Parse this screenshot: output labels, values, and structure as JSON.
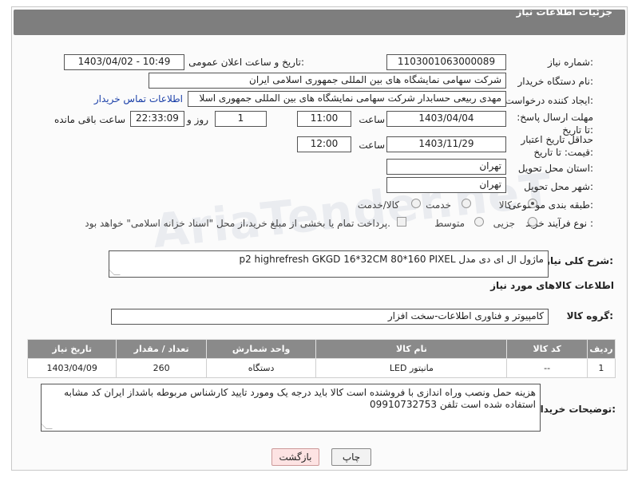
{
  "page": {
    "title": "جزئیات اطلاعات نیاز"
  },
  "need_number": {
    "label": "شماره نیاز:",
    "value": "1103001063000089"
  },
  "announce": {
    "label": "تاریخ و ساعت اعلان عمومی:",
    "value": "1403/04/02 - 10:49"
  },
  "buyer": {
    "label": "نام دستگاه خریدار:",
    "value": "شرکت سهامی نمایشگاه های بین المللی جمهوری اسلامی ایران"
  },
  "creator": {
    "label": "ایجاد کننده درخواست:",
    "value": "مهدی  ربیعی حسابدار شرکت سهامی نمایشگاه های بین المللی جمهوری اسلا",
    "contact_link": "اطلاعات تماس خریدار"
  },
  "deadline": {
    "label": "مهلت ارسال پاسخ: تا تاریخ:",
    "date": "1403/04/04",
    "time_label": "ساعت",
    "time": "11:00",
    "days": "1",
    "days_label": "روز و",
    "remaining": "22:33:09",
    "remaining_label": "ساعت باقی مانده"
  },
  "validity": {
    "label": "حداقل تاریخ اعتبار قیمت: تا تاریخ:",
    "date": "1403/11/29",
    "time_label": "ساعت",
    "time": "12:00"
  },
  "province": {
    "label": "استان محل تحویل:",
    "value": "تهران"
  },
  "city": {
    "label": "شهر محل تحویل:",
    "value": "تهران"
  },
  "category": {
    "label": "طبقه بندی موضوعی:",
    "options": [
      "کالا",
      "خدمت",
      "کالا/خدمت"
    ],
    "selected": "کالا"
  },
  "process": {
    "label": "نوع فرآیند خرید :",
    "options": [
      "جزیی",
      "متوسط"
    ],
    "note": "پرداخت تمام یا بخشی از مبلغ خرید،از محل \"اسناد خزانه اسلامی\" خواهد بود."
  },
  "description": {
    "label": "شرح کلی نیاز:",
    "value": "ماژول ال ای دی مدل  p2 highrefresh GKGD 16*32CM 80*160 PIXEL"
  },
  "goods_section": {
    "title": "اطلاعات کالاهای مورد نیاز"
  },
  "goods_group": {
    "label": "گروه کالا:",
    "value": "کامپیوتر و فناوری اطلاعات-سخت افزار"
  },
  "table": {
    "headers": [
      "ردیف",
      "کد کالا",
      "نام کالا",
      "واحد شمارش",
      "تعداد / مقدار",
      "تاریخ نیاز"
    ],
    "rows": [
      [
        "1",
        "--",
        "مانیتور LED",
        "دستگاه",
        "260",
        "1403/04/09"
      ]
    ]
  },
  "buyer_notes": {
    "label": "توضیحات خریدار:",
    "value": "هزینه حمل ونصب وراه اندازی با فروشنده است کالا باید درجه یک ومورد تایید کارشناس مربوطه باشداز ایران کد مشابه استفاده شده است تلفن 09910732753"
  },
  "buttons": {
    "print": "چاپ",
    "back": "بازگشت"
  },
  "watermark": "AriaTender.neT"
}
